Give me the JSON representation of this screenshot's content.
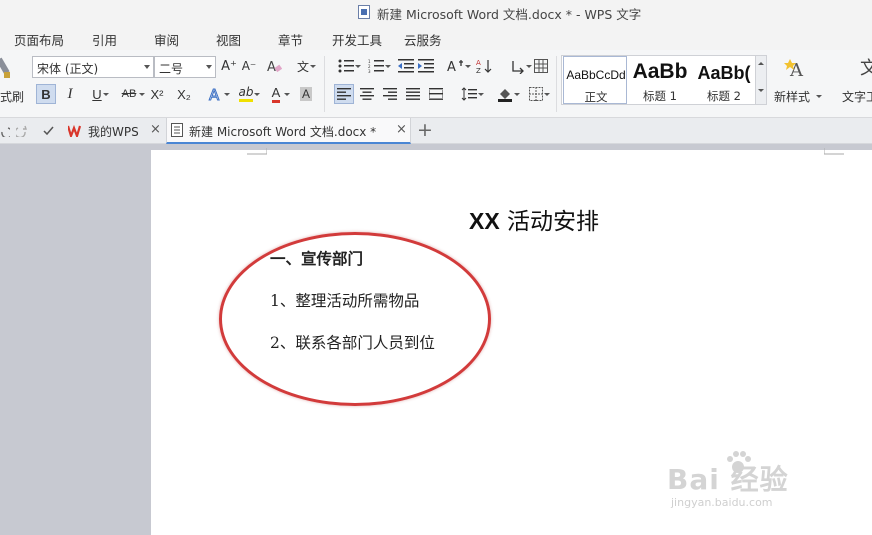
{
  "window": {
    "title": "新建 Microsoft Word 文档.docx * - WPS 文字"
  },
  "menu_tabs": [
    "页面布局",
    "引用",
    "审阅",
    "视图",
    "章节",
    "开发工具",
    "云服务"
  ],
  "ribbon": {
    "format_painter_label": "式刷",
    "font_name": "宋体 (正文)",
    "font_size": "二号",
    "bold": "B",
    "italic": "I",
    "underline": "U",
    "strikethrough": "AB",
    "superscript": "X²",
    "subscript": "X₂",
    "grow_font": "A⁺",
    "shrink_font": "A⁻",
    "phonetic": "文",
    "font_color": "A",
    "highlight": "ab",
    "char_shading": "A",
    "styles": [
      {
        "preview": "AaBbCcDd",
        "name": "正文"
      },
      {
        "preview": "AaBb",
        "name": "标题 1"
      },
      {
        "preview": "AaBb(",
        "name": "标题 2"
      }
    ],
    "new_style_label": "新样式",
    "text_tool_label": "文字工"
  },
  "doc_tabs": [
    {
      "label": "我的WPS"
    },
    {
      "label": "新建 Microsoft Word 文档.docx *"
    }
  ],
  "document": {
    "title_latin": "XX",
    "title_cjk": " 活动安排",
    "heading": "一、宣传部门",
    "items": [
      "1、整理活动所需物品",
      "2、联系各部门人员到位"
    ]
  },
  "watermark": {
    "brand": "Bai 经验",
    "url": "jingyan.baidu.com"
  },
  "colors": {
    "accent": "#4a86d4",
    "ellipse": "#d23b3b",
    "wps_red": "#d9362b"
  }
}
